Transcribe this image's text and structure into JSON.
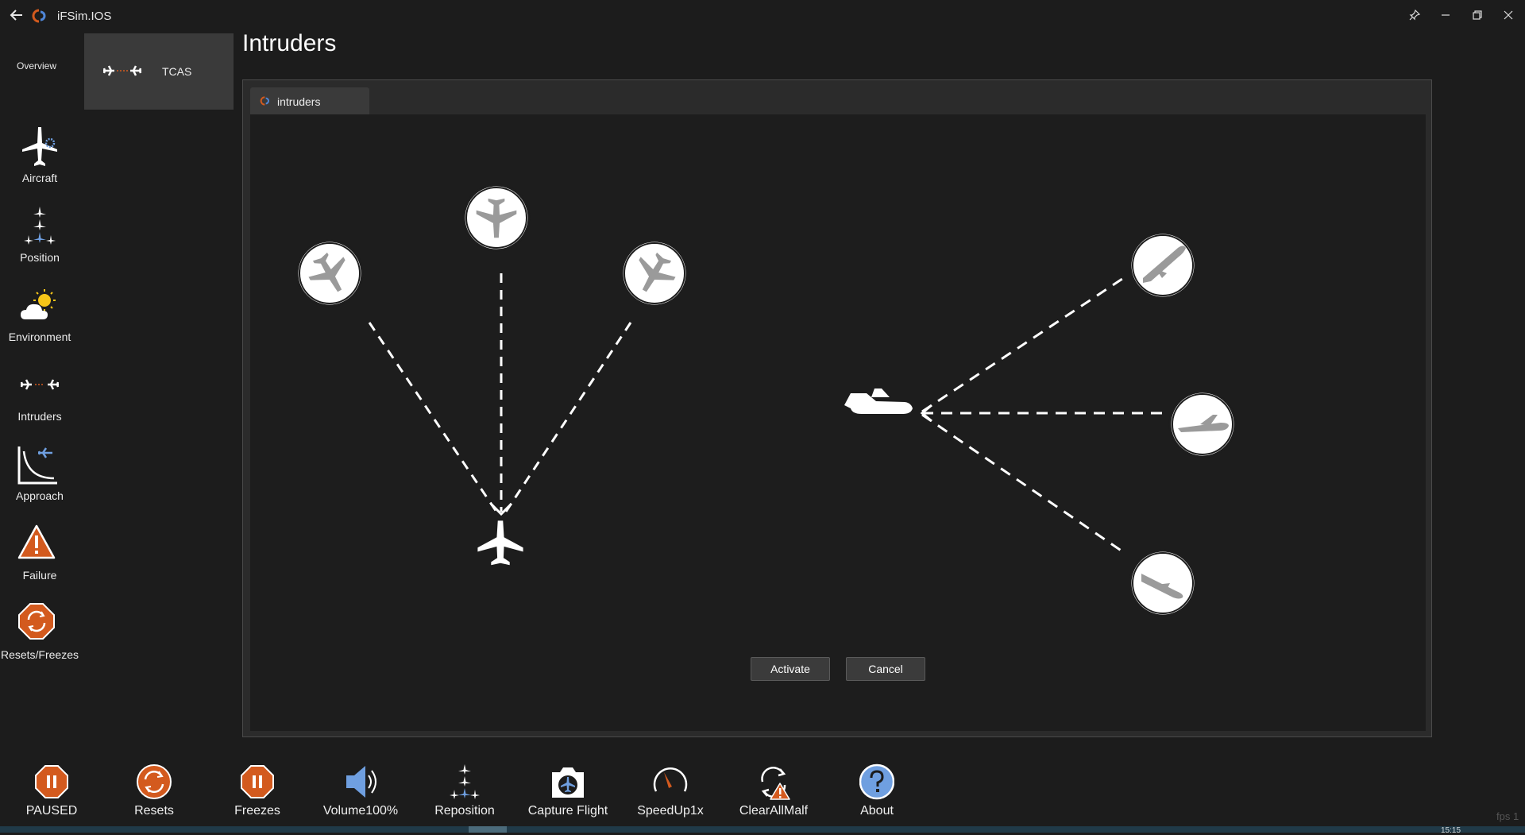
{
  "window": {
    "app_title": "iFSim.IOS",
    "fps_text": "fps 1",
    "clock_text": "15:15"
  },
  "nav": {
    "overview_label": "Overview",
    "items": [
      {
        "label": "Aircraft",
        "icon": "aircraft-icon"
      },
      {
        "label": "Position",
        "icon": "position-icon"
      },
      {
        "label": "Environment",
        "icon": "environment-icon"
      },
      {
        "label": "Intruders",
        "icon": "intruders-icon"
      },
      {
        "label": "Approach",
        "icon": "approach-icon"
      },
      {
        "label": "Failure",
        "icon": "failure-icon"
      },
      {
        "label": "Resets/Freezes",
        "icon": "resets-freezes-icon"
      }
    ]
  },
  "subnav": {
    "card_label": "TCAS",
    "card_icon": "tcas-icon"
  },
  "page": {
    "title": "Intruders",
    "tab_label": "intruders",
    "activate_label": "Activate",
    "cancel_label": "Cancel"
  },
  "toolbar": {
    "items": [
      {
        "label": "PAUSED",
        "icon": "pause-icon"
      },
      {
        "label": "Resets",
        "icon": "reset-icon"
      },
      {
        "label": "Freezes",
        "icon": "freeze-icon"
      },
      {
        "label": "Volume100%",
        "icon": "speaker-icon"
      },
      {
        "label": "Reposition",
        "icon": "reposition-icon"
      },
      {
        "label": "Capture Flight",
        "icon": "camera-icon"
      },
      {
        "label": "SpeedUp1x",
        "icon": "speedometer-icon"
      },
      {
        "label": "ClearAllMalf",
        "icon": "clear-malfunction-icon"
      },
      {
        "label": "About",
        "icon": "help-icon"
      }
    ]
  },
  "colors": {
    "background": "#1c1c1c",
    "panel": "#2b2b2b",
    "accent_orange": "#d35a1e",
    "accent_blue": "#6f9fe0"
  }
}
